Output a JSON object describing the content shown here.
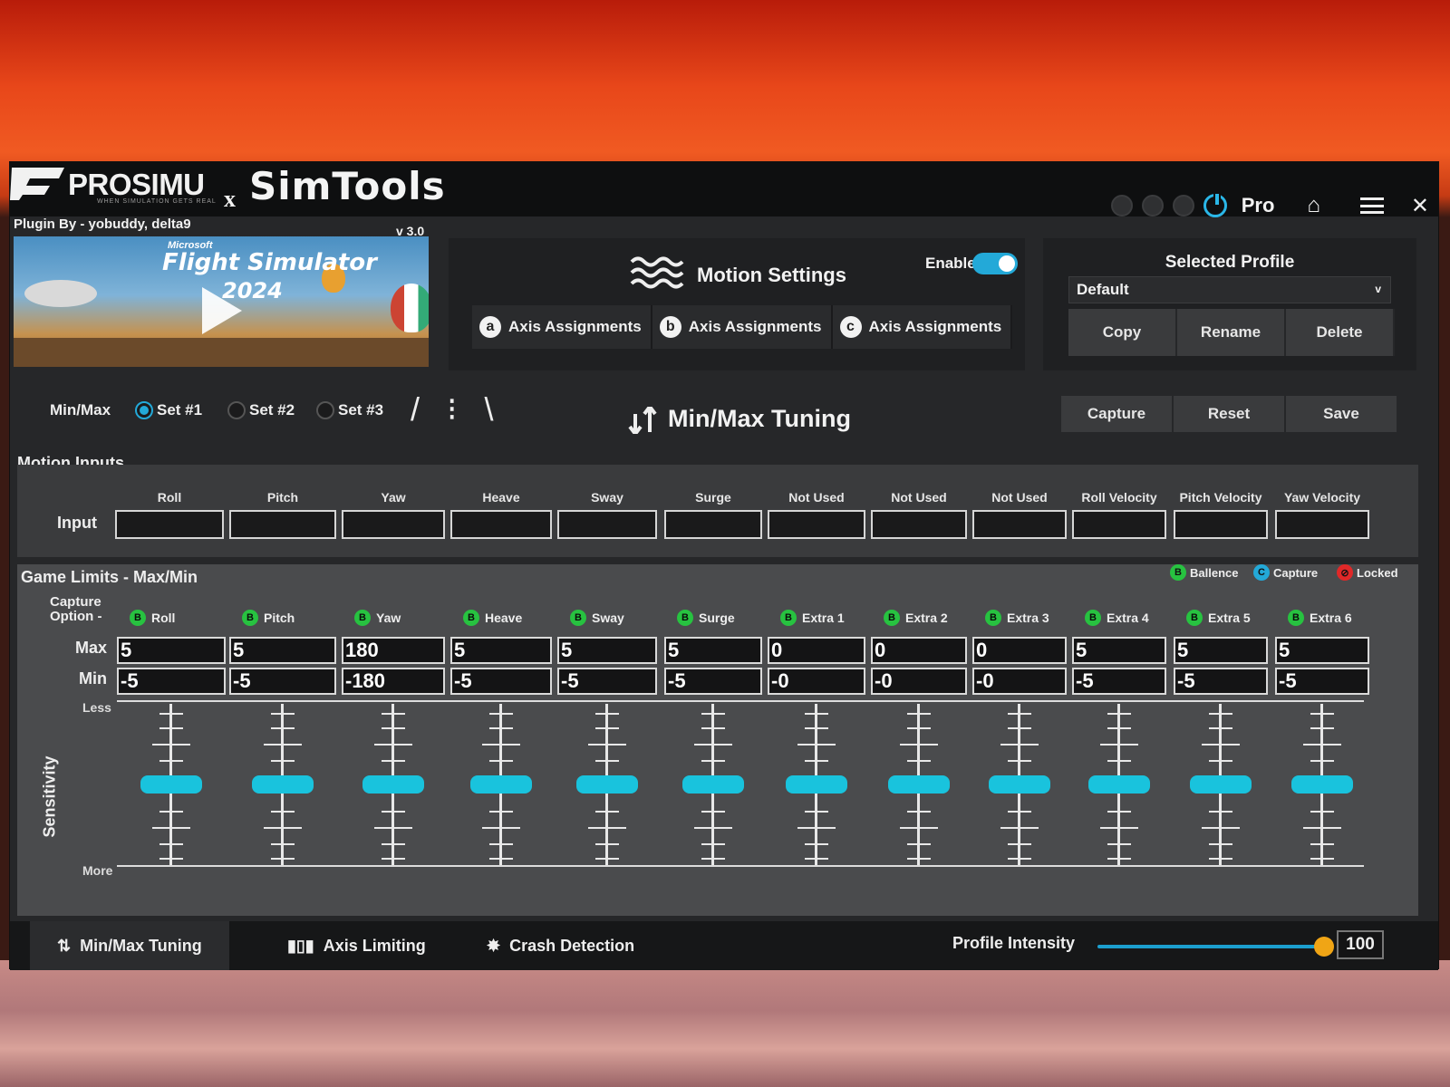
{
  "header": {
    "brand": "PROSIMU",
    "brand_tagline": "WHEN SIMULATION GETS REAL",
    "x": "x",
    "brand2": "SimTools",
    "pro": "Pro",
    "plugin_by": "Plugin By - yobuddy, delta9",
    "version": "v 3.0",
    "banner": {
      "subtitle": "Microsoft",
      "title": "Flight Simulator",
      "year": "2024"
    }
  },
  "motion_settings": {
    "title": "Motion Settings",
    "enable_label": "Enable",
    "enabled": true,
    "axis_tabs": [
      {
        "badge": "a",
        "label": "Axis Assignments"
      },
      {
        "badge": "b",
        "label": "Axis Assignments"
      },
      {
        "badge": "c",
        "label": "Axis Assignments"
      }
    ]
  },
  "profile": {
    "title": "Selected Profile",
    "selected": "Default",
    "buttons": [
      "Copy",
      "Rename",
      "Delete"
    ]
  },
  "sets": {
    "label": "Min/Max",
    "options": [
      "Set #1",
      "Set #2",
      "Set #3"
    ],
    "selected": 0,
    "slashes": "/ ⁝ \\"
  },
  "tuning": {
    "title": "Min/Max Tuning",
    "buttons": [
      "Capture",
      "Reset",
      "Save"
    ]
  },
  "motion_inputs": {
    "title": "Motion Inputs",
    "row_label": "Input",
    "columns": [
      "Roll",
      "Pitch",
      "Yaw",
      "Heave",
      "Sway",
      "Surge",
      "Not Used",
      "Not Used",
      "Not Used",
      "Roll Velocity",
      "Pitch Velocity",
      "Yaw Velocity"
    ]
  },
  "game_limits": {
    "title": "Game Limits - Max/Min",
    "legend": [
      {
        "badge": "B",
        "label": "Ballence",
        "color": "#27c240"
      },
      {
        "badge": "C",
        "label": "Capture",
        "color": "#23a9d8"
      },
      {
        "badge": "⊘",
        "label": "Locked",
        "color": "#e02828"
      }
    ],
    "capture_option": "Capture Option -",
    "max_label": "Max",
    "min_label": "Min",
    "less_label": "Less",
    "more_label": "More",
    "sensitivity_label": "Sensitivity",
    "columns": [
      {
        "name": "Roll",
        "badge": "B",
        "max": "5",
        "min": "-5",
        "sensitivity": 0.5
      },
      {
        "name": "Pitch",
        "badge": "B",
        "max": "5",
        "min": "-5",
        "sensitivity": 0.5
      },
      {
        "name": "Yaw",
        "badge": "B",
        "max": "180",
        "min": "-180",
        "sensitivity": 0.5
      },
      {
        "name": "Heave",
        "badge": "B",
        "max": "5",
        "min": "-5",
        "sensitivity": 0.5
      },
      {
        "name": "Sway",
        "badge": "B",
        "max": "5",
        "min": "-5",
        "sensitivity": 0.5
      },
      {
        "name": "Surge",
        "badge": "B",
        "max": "5",
        "min": "-5",
        "sensitivity": 0.5
      },
      {
        "name": "Extra 1",
        "badge": "B",
        "max": "0",
        "min": "-0",
        "sensitivity": 0.5
      },
      {
        "name": "Extra 2",
        "badge": "B",
        "max": "0",
        "min": "-0",
        "sensitivity": 0.5
      },
      {
        "name": "Extra 3",
        "badge": "B",
        "max": "0",
        "min": "-0",
        "sensitivity": 0.5
      },
      {
        "name": "Extra 4",
        "badge": "B",
        "max": "5",
        "min": "-5",
        "sensitivity": 0.5
      },
      {
        "name": "Extra 5",
        "badge": "B",
        "max": "5",
        "min": "-5",
        "sensitivity": 0.5
      },
      {
        "name": "Extra 6",
        "badge": "B",
        "max": "5",
        "min": "-5",
        "sensitivity": 0.5
      }
    ]
  },
  "bottom": {
    "tabs": [
      {
        "icon": "min-max-tuning-icon",
        "label": "Min/Max Tuning"
      },
      {
        "icon": "axis-limiting-icon",
        "label": "Axis Limiting"
      },
      {
        "icon": "crash-detection-icon",
        "label": "Crash Detection"
      }
    ],
    "active_tab": 0,
    "intensity_label": "Profile Intensity",
    "intensity_value": "100",
    "intensity_fraction": 1.0
  },
  "colors": {
    "accent": "#23a9d8",
    "thumb": "#19c3dd",
    "knob": "#f0a515",
    "balance": "#27c240",
    "locked": "#e02828"
  }
}
